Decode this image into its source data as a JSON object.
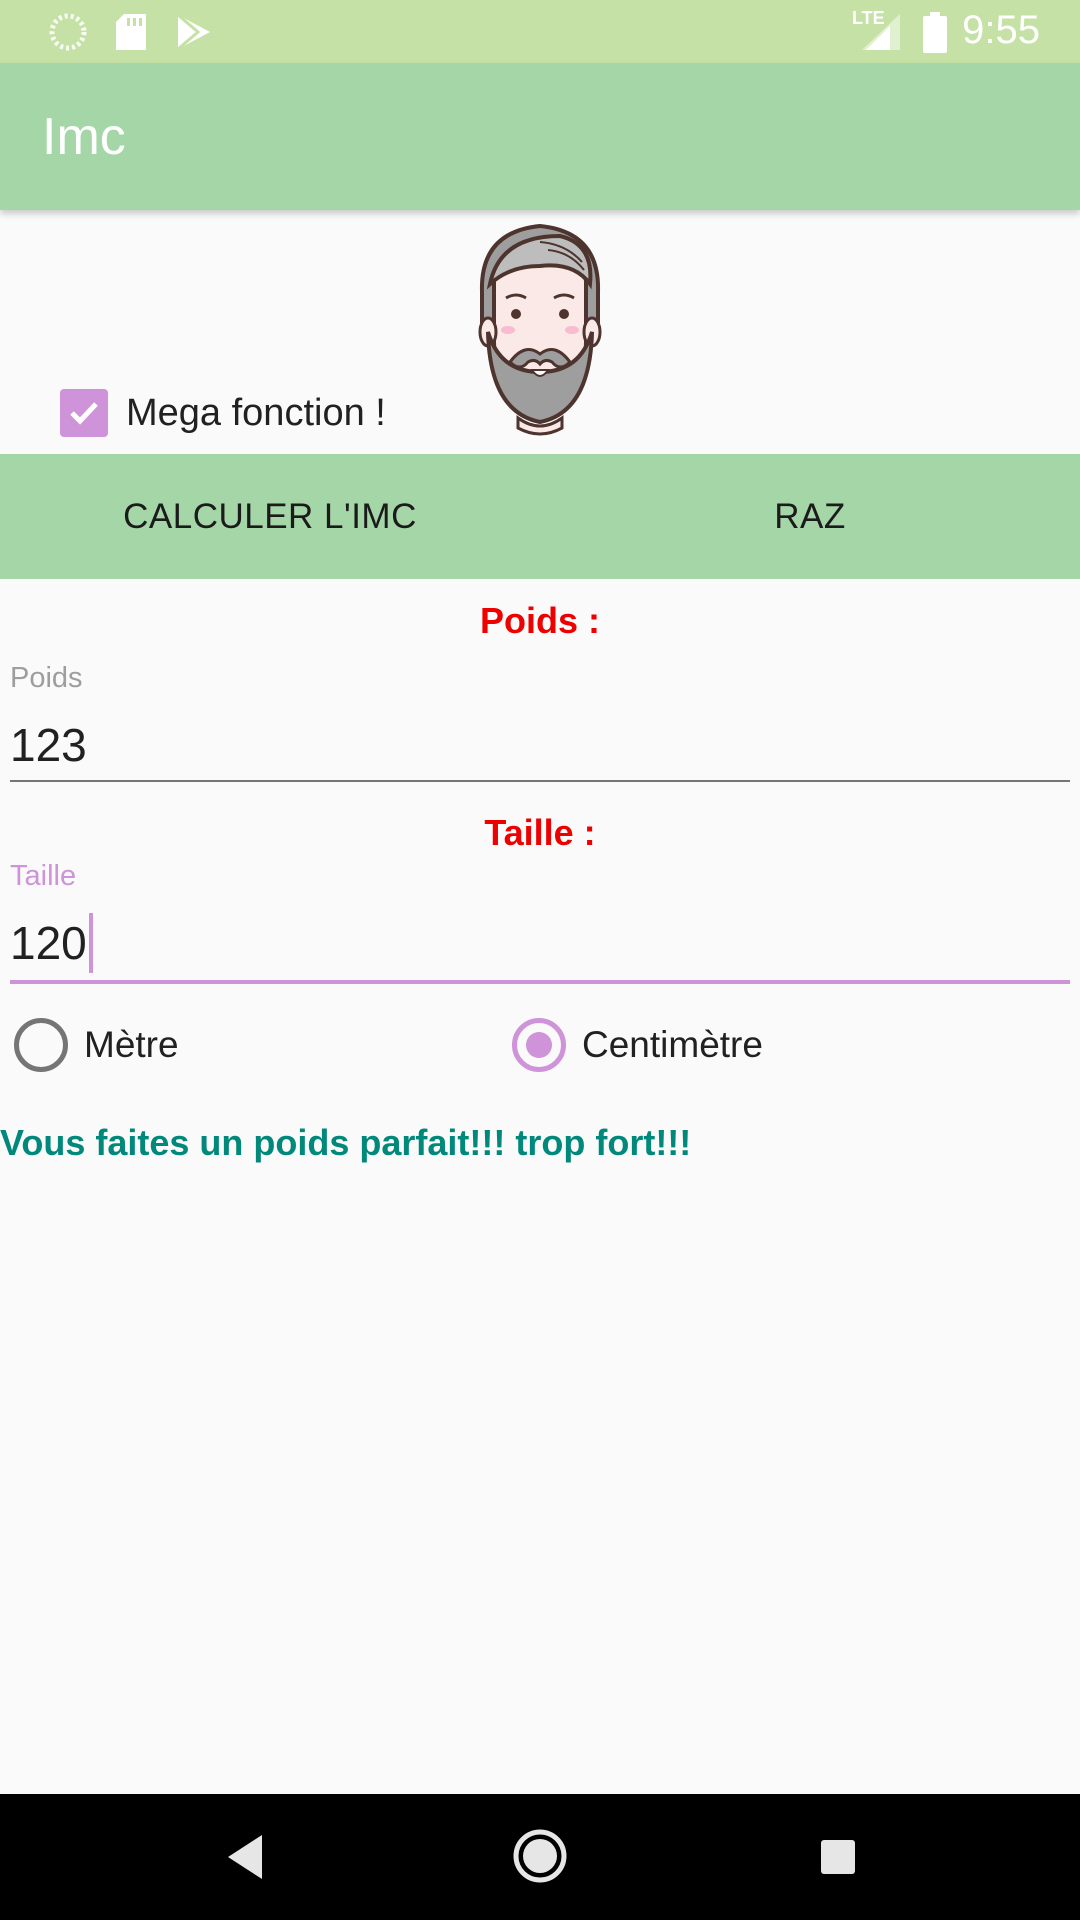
{
  "status_bar": {
    "time": "9:55",
    "network": "LTE",
    "icons": [
      "loading-icon",
      "sd-card-icon",
      "play-store-icon",
      "signal-icon",
      "battery-icon"
    ]
  },
  "app_bar": {
    "title": "Imc"
  },
  "checkbox": {
    "label": "Mega fonction !",
    "checked": true
  },
  "buttons": {
    "calculate_label": "CALCULER L'IMC",
    "reset_label": "RAZ"
  },
  "weight": {
    "section_label": "Poids :",
    "hint": "Poids",
    "value": "123"
  },
  "height": {
    "section_label": "Taille :",
    "hint": "Taille",
    "value": "120"
  },
  "units": {
    "options": [
      {
        "label": "Mètre",
        "selected": false
      },
      {
        "label": "Centimètre",
        "selected": true
      }
    ]
  },
  "result": {
    "text": "Vous faites un poids parfait!!! trop fort!!!"
  },
  "nav_bar": {
    "icons": [
      "back-icon",
      "home-icon",
      "recents-icon"
    ]
  },
  "colors": {
    "status_bar": "#c5e1a5",
    "app_bar": "#a5d6a7",
    "accent": "#ce93d8",
    "label_red": "#ee0000",
    "result_teal": "#00897b",
    "hint_grey": "#9e9e9e",
    "underline_grey": "#757575"
  }
}
